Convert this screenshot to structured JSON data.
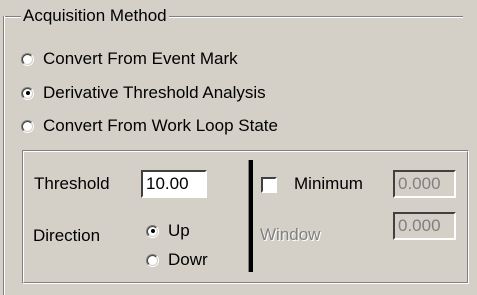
{
  "group": {
    "title": "Acquisition Method"
  },
  "methods": [
    {
      "label": "Convert From Event Mark",
      "selected": false
    },
    {
      "label": "Derivative Threshold Analysis",
      "selected": true
    },
    {
      "label": "Convert From Work Loop State",
      "selected": false
    }
  ],
  "threshold": {
    "label": "Threshold",
    "value": "10.00"
  },
  "direction": {
    "label": "Direction",
    "options": [
      {
        "label": "Up",
        "selected": true
      },
      {
        "label": "Dowr",
        "selected": false
      }
    ]
  },
  "minimum": {
    "label": "Minimum",
    "checked": false,
    "value": "0.000"
  },
  "window": {
    "label": "Window",
    "value": "0.000"
  }
}
